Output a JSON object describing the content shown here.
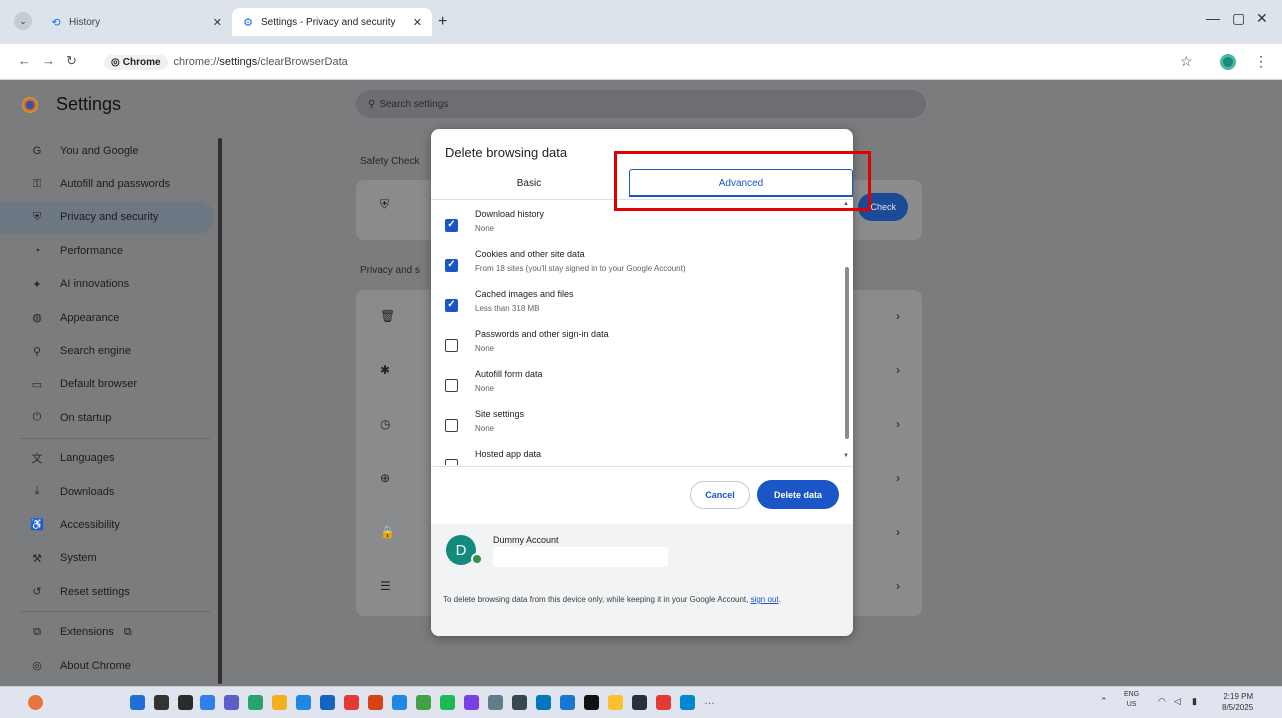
{
  "tabs": {
    "inactive_title": "History",
    "active_title": "Settings - Privacy and security"
  },
  "toolbar": {
    "chip_label": "Chrome",
    "url_prefix": "chrome://",
    "url_host": "settings",
    "url_path": "/clearBrowserData"
  },
  "settings": {
    "title": "Settings",
    "search_placeholder": "Search settings",
    "sidebar": [
      {
        "label": "You and Google",
        "icon": "google-icon",
        "glyph": "G"
      },
      {
        "label": "Autofill and passwords",
        "icon": "key-icon",
        "glyph": "⚿"
      },
      {
        "label": "Privacy and security",
        "icon": "shield-icon",
        "glyph": "⛨",
        "selected": true
      },
      {
        "label": "Performance",
        "icon": "gauge-icon",
        "glyph": "◔"
      },
      {
        "label": "AI innovations",
        "icon": "sparkle-icon",
        "glyph": "✦"
      },
      {
        "label": "Appearance",
        "icon": "palette-icon",
        "glyph": "◍"
      },
      {
        "label": "Search engine",
        "icon": "search-icon",
        "glyph": "⚲"
      },
      {
        "label": "Default browser",
        "icon": "browser-icon",
        "glyph": "▭"
      },
      {
        "label": "On startup",
        "icon": "power-icon",
        "glyph": "⏻"
      },
      {
        "label": "Languages",
        "icon": "translate-icon",
        "glyph": "文"
      },
      {
        "label": "Downloads",
        "icon": "download-icon",
        "glyph": "⤓"
      },
      {
        "label": "Accessibility",
        "icon": "accessibility-icon",
        "glyph": "♿"
      },
      {
        "label": "System",
        "icon": "wrench-icon",
        "glyph": "⚒"
      },
      {
        "label": "Reset settings",
        "icon": "reset-icon",
        "glyph": "↺"
      },
      {
        "label": "Extensions",
        "icon": "extension-icon",
        "glyph": "⧉"
      },
      {
        "label": "About Chrome",
        "icon": "chrome-icon",
        "glyph": "◎"
      }
    ],
    "safety_check_label": "Safety Check",
    "safety_check_button": "Check",
    "privacy_label": "Privacy and s"
  },
  "dialog": {
    "title": "Delete browsing data",
    "tab_basic": "Basic",
    "tab_advanced": "Advanced",
    "items": [
      {
        "label": "Download history",
        "sub": "None",
        "checked": true
      },
      {
        "label": "Cookies and other site data",
        "sub": "From 18 sites (you'll stay signed in to your Google Account)",
        "checked": true
      },
      {
        "label": "Cached images and files",
        "sub": "Less than 318 MB",
        "checked": true
      },
      {
        "label": "Passwords and other sign-in data",
        "sub": "None",
        "checked": false
      },
      {
        "label": "Autofill form data",
        "sub": "None",
        "checked": false
      },
      {
        "label": "Site settings",
        "sub": "None",
        "checked": false
      },
      {
        "label": "Hosted app data",
        "sub": "",
        "checked": false
      }
    ],
    "cancel_label": "Cancel",
    "delete_label": "Delete data",
    "account_name": "Dummy Account",
    "avatar_letter": "D",
    "footnote_text": "To delete browsing data from this device only, while keeping it in your Google Account, ",
    "sign_out_label": "sign out"
  },
  "taskbar": {
    "lang_top": "ENG",
    "lang_bottom": "US",
    "time": "2:19 PM",
    "date": "8/5/2025"
  },
  "colors": {
    "accent": "#1a56c7",
    "highlight": "#e00000",
    "overlay": "#7b7c7e"
  }
}
